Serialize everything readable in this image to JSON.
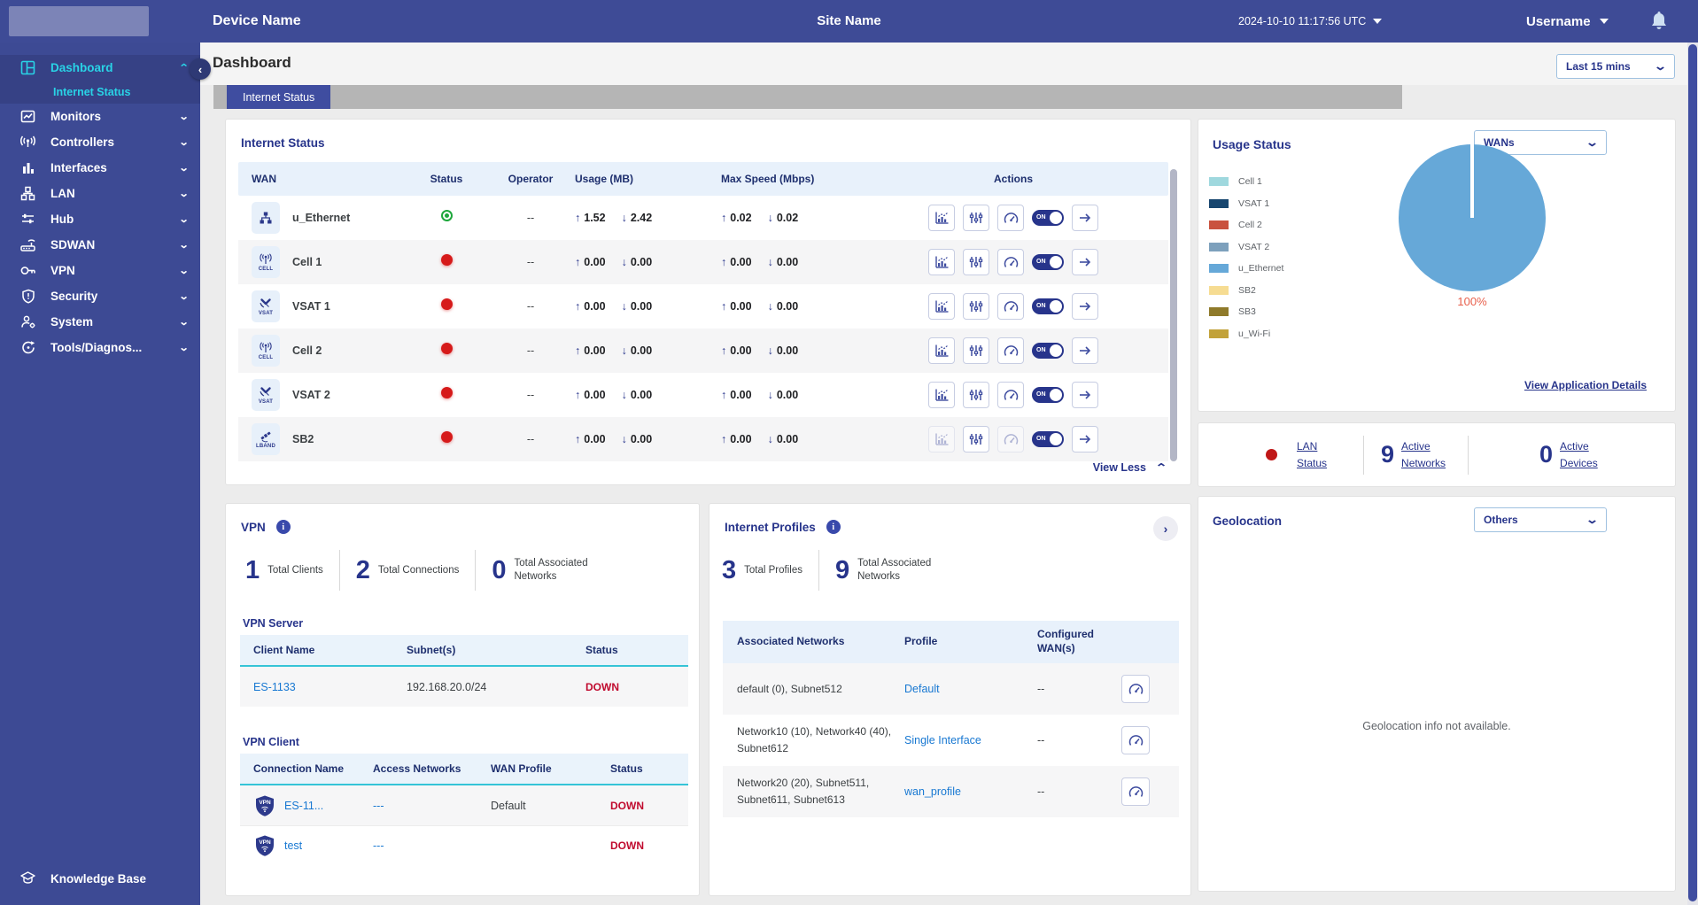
{
  "header": {
    "device_name": "Device Name",
    "site_name": "Site Name",
    "timestamp": "2024-10-10 11:17:56 UTC",
    "username": "Username"
  },
  "sidebar": {
    "items": [
      {
        "label": "Dashboard",
        "icon": "dashboard",
        "active": true,
        "expanded": true
      },
      {
        "label": "Monitors",
        "icon": "monitors"
      },
      {
        "label": "Controllers",
        "icon": "controllers"
      },
      {
        "label": "Interfaces",
        "icon": "interfaces"
      },
      {
        "label": "LAN",
        "icon": "lan"
      },
      {
        "label": "Hub",
        "icon": "hub"
      },
      {
        "label": "SDWAN",
        "icon": "sdwan"
      },
      {
        "label": "VPN",
        "icon": "vpn"
      },
      {
        "label": "Security",
        "icon": "security"
      },
      {
        "label": "System",
        "icon": "system"
      },
      {
        "label": "Tools/Diagnos...",
        "icon": "tools"
      }
    ],
    "active_sub_item": "Internet Status",
    "footer_label": "Knowledge Base"
  },
  "page": {
    "title": "Dashboard",
    "time_range": "Last 15 mins",
    "tab": "Internet Status"
  },
  "internet_status": {
    "title": "Internet Status",
    "columns": [
      "WAN",
      "Status",
      "Operator",
      "Usage (MB)",
      "Max Speed (Mbps)",
      "Actions"
    ],
    "toggle_label": "ON",
    "view_less": "View Less",
    "rows": [
      {
        "wan": "u_Ethernet",
        "icon": "ethernet",
        "icon_label": "",
        "status": "up",
        "operator": "--",
        "usage_up": "1.52",
        "usage_down": "2.42",
        "speed_up": "0.02",
        "speed_down": "0.02",
        "disabled": []
      },
      {
        "wan": "Cell 1",
        "icon": "cell",
        "icon_label": "CELL",
        "status": "down",
        "operator": "--",
        "usage_up": "0.00",
        "usage_down": "0.00",
        "speed_up": "0.00",
        "speed_down": "0.00",
        "disabled": []
      },
      {
        "wan": "VSAT 1",
        "icon": "vsat",
        "icon_label": "VSAT",
        "status": "down",
        "operator": "--",
        "usage_up": "0.00",
        "usage_down": "0.00",
        "speed_up": "0.00",
        "speed_down": "0.00",
        "disabled": []
      },
      {
        "wan": "Cell 2",
        "icon": "cell",
        "icon_label": "CELL",
        "status": "down",
        "operator": "--",
        "usage_up": "0.00",
        "usage_down": "0.00",
        "speed_up": "0.00",
        "speed_down": "0.00",
        "disabled": []
      },
      {
        "wan": "VSAT 2",
        "icon": "vsat",
        "icon_label": "VSAT",
        "status": "down",
        "operator": "--",
        "usage_up": "0.00",
        "usage_down": "0.00",
        "speed_up": "0.00",
        "speed_down": "0.00",
        "disabled": []
      },
      {
        "wan": "SB2",
        "icon": "lband",
        "icon_label": "LBAND",
        "status": "down",
        "operator": "--",
        "usage_up": "0.00",
        "usage_down": "0.00",
        "speed_up": "0.00",
        "speed_down": "0.00",
        "disabled": [
          "chart",
          "speedtest"
        ]
      }
    ]
  },
  "usage_status": {
    "title": "Usage Status",
    "filter": "WANs",
    "link": "View Application Details",
    "legend": [
      {
        "label": "Cell 1",
        "color": "#9fd8de"
      },
      {
        "label": "VSAT 1",
        "color": "#17466f"
      },
      {
        "label": "Cell 2",
        "color": "#c9523f"
      },
      {
        "label": "VSAT 2",
        "color": "#7da0bc"
      },
      {
        "label": "u_Ethernet",
        "color": "#66a8d8"
      },
      {
        "label": "SB2",
        "color": "#f6dc92"
      },
      {
        "label": "SB3",
        "color": "#8f7a2a"
      },
      {
        "label": "u_Wi-Fi",
        "color": "#c2a23a"
      }
    ],
    "chart_data": {
      "type": "pie",
      "title": "Usage Status",
      "slices": [
        {
          "label": "u_Ethernet",
          "value": 100,
          "color": "#66a8d8"
        }
      ],
      "data_label": "100%",
      "data_label_color": "#e8604c",
      "legend_position": "left"
    }
  },
  "lan_summary": {
    "items": [
      {
        "value": "",
        "label": "LAN Status",
        "dot": true
      },
      {
        "value": "9",
        "label": "Active Networks",
        "dot": false
      },
      {
        "value": "0",
        "label": "Active Devices",
        "dot": false
      }
    ]
  },
  "vpn": {
    "title": "VPN",
    "stats": [
      {
        "value": "1",
        "label": "Total Clients"
      },
      {
        "value": "2",
        "label": "Total Connections"
      },
      {
        "value": "0",
        "label": "Total Associated Networks"
      }
    ],
    "server": {
      "title": "VPN Server",
      "columns": [
        "Client Name",
        "Subnet(s)",
        "Status"
      ],
      "rows": [
        {
          "client": "ES-1133",
          "subnet": "192.168.20.0/24",
          "status": "DOWN"
        }
      ]
    },
    "client": {
      "title": "VPN Client",
      "columns": [
        "Connection Name",
        "Access Networks",
        "WAN Profile",
        "Status"
      ],
      "rows": [
        {
          "name": "ES-11...",
          "access": "---",
          "profile": "Default",
          "status": "DOWN"
        },
        {
          "name": "test",
          "access": "---",
          "profile": "",
          "status": "DOWN"
        }
      ]
    }
  },
  "internet_profiles": {
    "title": "Internet Profiles",
    "stats": [
      {
        "value": "3",
        "label": "Total Profiles"
      },
      {
        "value": "9",
        "label": "Total Associated Networks"
      }
    ],
    "columns": [
      "Associated Networks",
      "Profile",
      "Configured WAN(s)"
    ],
    "rows": [
      {
        "networks": "default (0), Subnet512",
        "profile": "Default",
        "wans": "--"
      },
      {
        "networks": "Network10 (10), Network40 (40), Subnet612",
        "profile": "Single Interface",
        "wans": "--"
      },
      {
        "networks": "Network20 (20), Subnet511, Subnet611, Subnet613",
        "profile": "wan_profile",
        "wans": "--"
      }
    ]
  },
  "geolocation": {
    "title": "Geolocation",
    "filter": "Others",
    "message": "Geolocation info not available."
  }
}
